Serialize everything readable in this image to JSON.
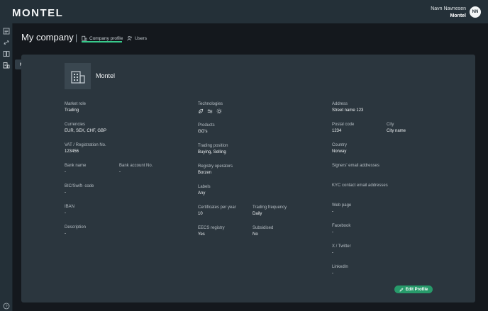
{
  "header": {
    "logo_text": "MONTEL",
    "user_name": "Navn Navnesen",
    "user_org": "Montel",
    "avatar_initials": "NN"
  },
  "sidebar": {
    "items": [
      {
        "icon": "document-list-icon"
      },
      {
        "icon": "swap-icon"
      },
      {
        "icon": "book-icon"
      },
      {
        "icon": "company-icon",
        "active": true
      }
    ],
    "tooltip": "My Company",
    "help_icon": "help-icon"
  },
  "page": {
    "title": "My company",
    "separator": "|",
    "tabs": [
      {
        "label": "Company profile",
        "active": true
      },
      {
        "label": "Users",
        "active": false
      }
    ]
  },
  "company": {
    "name": "Montel"
  },
  "fields": {
    "market_role": {
      "label": "Market role",
      "value": "Trading"
    },
    "currencies": {
      "label": "Currencies",
      "value": "EUR, SEK, CHF, GBP"
    },
    "vat": {
      "label": "VAT / Registration No.",
      "value": "123456"
    },
    "bank_name": {
      "label": "Bank name",
      "value": "-"
    },
    "bank_account": {
      "label": "Bank account No.",
      "value": "-"
    },
    "bic": {
      "label": "BIC/Swift- code",
      "value": "-"
    },
    "iban": {
      "label": "IBAN",
      "value": "-"
    },
    "description": {
      "label": "Description",
      "value": "-"
    },
    "technologies": {
      "label": "Technologies",
      "icons": [
        "leaf-icon",
        "waves-icon",
        "sun-icon"
      ]
    },
    "products": {
      "label": "Products",
      "value": "GO's"
    },
    "trading_position": {
      "label": "Trading position",
      "value": "Buying, Selling"
    },
    "registry_operators": {
      "label": "Registry operators",
      "value": "Borzen"
    },
    "labels": {
      "label": "Labels",
      "value": "Any"
    },
    "certificates_per_year": {
      "label": "Certificates per year",
      "value": "10"
    },
    "trading_frequency": {
      "label": "Trading frequency",
      "value": "Daily"
    },
    "eecs_registry": {
      "label": "EECS registry",
      "value": "Yes"
    },
    "subsidised": {
      "label": "Subsidised",
      "value": "No"
    },
    "address": {
      "label": "Address",
      "value": "Street name 123"
    },
    "postal_code": {
      "label": "Postal code",
      "value": "1234"
    },
    "city": {
      "label": "City",
      "value": "City name"
    },
    "country": {
      "label": "Country",
      "value": "Norway"
    },
    "signers_email": {
      "label": "Signers' email addresses",
      "value": ""
    },
    "kyc_email": {
      "label": "KYC contact email addresses",
      "value": ""
    },
    "web_page": {
      "label": "Web page",
      "value": "-"
    },
    "facebook": {
      "label": "Facebook",
      "value": "-"
    },
    "twitter": {
      "label": "X / Twitter",
      "value": "-"
    },
    "linkedin": {
      "label": "LinkedIn",
      "value": "-"
    }
  },
  "actions": {
    "edit_label": "Edit Profile"
  },
  "colors": {
    "accent": "#38c98b",
    "button": "#279a6a",
    "panel": "#2b363e",
    "topbar": "#243038"
  }
}
